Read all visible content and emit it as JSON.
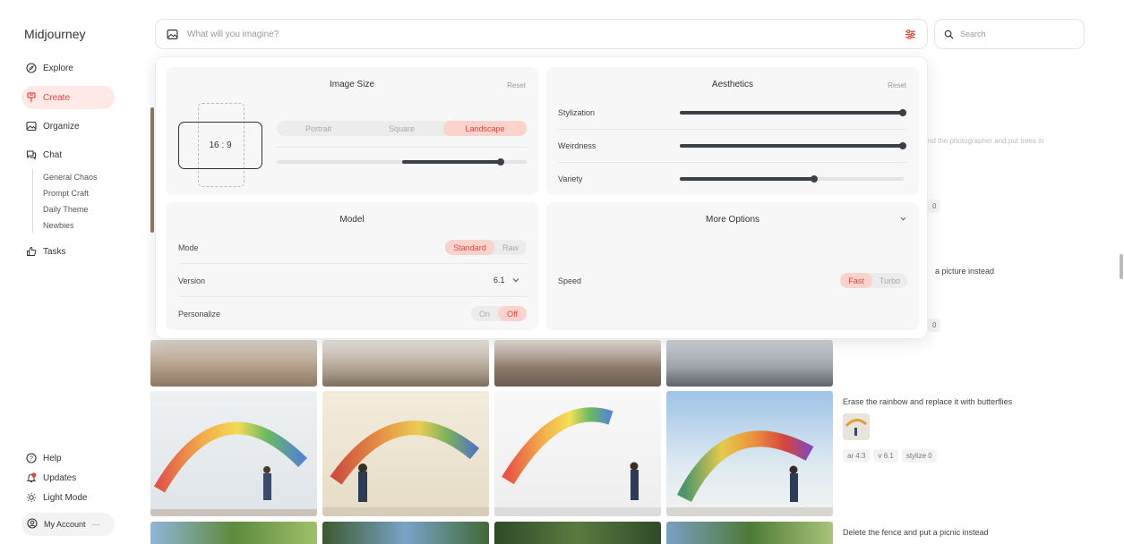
{
  "sidebar": {
    "logo": "Midjourney",
    "items": [
      {
        "label": "Explore",
        "icon": "compass-icon"
      },
      {
        "label": "Create",
        "icon": "brush-icon",
        "active": true
      },
      {
        "label": "Organize",
        "icon": "image-icon"
      },
      {
        "label": "Chat",
        "icon": "chat-icon"
      }
    ],
    "chat_channels": [
      "General Chaos",
      "Prompt Craft",
      "Daily Theme",
      "Newbies"
    ],
    "tasks_label": "Tasks",
    "bottom": [
      {
        "label": "Help",
        "icon": "help-icon"
      },
      {
        "label": "Updates",
        "icon": "bell-icon"
      },
      {
        "label": "Light Mode",
        "icon": "sun-icon"
      }
    ],
    "account_label": "My Account",
    "account_more": "···"
  },
  "prompt": {
    "placeholder": "What will you imagine?"
  },
  "search": {
    "placeholder": "Search"
  },
  "settings": {
    "image_size": {
      "title": "Image Size",
      "reset": "Reset",
      "ratio": "16 : 9",
      "orientations": [
        "Portrait",
        "Square",
        "Landscape"
      ],
      "selected": "Landscape",
      "slider_value": 0.9
    },
    "aesthetics": {
      "title": "Aesthetics",
      "reset": "Reset",
      "sliders": [
        {
          "label": "Stylization",
          "value": 1.0
        },
        {
          "label": "Weirdness",
          "value": 1.0
        },
        {
          "label": "Variety",
          "value": 0.6
        }
      ]
    },
    "model": {
      "title": "Model",
      "mode_label": "Mode",
      "mode_options": [
        "Standard",
        "Raw"
      ],
      "mode_selected": "Standard",
      "version_label": "Version",
      "version_value": "6.1",
      "personalize_label": "Personalize",
      "personalize_options": [
        "On",
        "Off"
      ],
      "personalize_selected": "Off"
    },
    "more_options": {
      "title": "More Options",
      "speed_label": "Speed",
      "speed_options": [
        "Fast",
        "Turbo"
      ],
      "speed_selected": "Fast"
    }
  },
  "feed": {
    "partial_text_1": "nd the photographer and put trees in",
    "partial_chip_1": "0",
    "partial_text_2": "a picture instead",
    "partial_chip_2": "0",
    "prompt_butterflies": "Erase the rainbow and replace it with butterflies",
    "chips_butterflies": [
      "ar 4:3",
      "v 6.1",
      "stylize 0"
    ],
    "prompt_picnic": "Delete the fence and put a picnic instead"
  },
  "colors": {
    "accent": "#e2483d",
    "accent_bg": "#fbd2cc",
    "slider": "#3b3f48"
  }
}
